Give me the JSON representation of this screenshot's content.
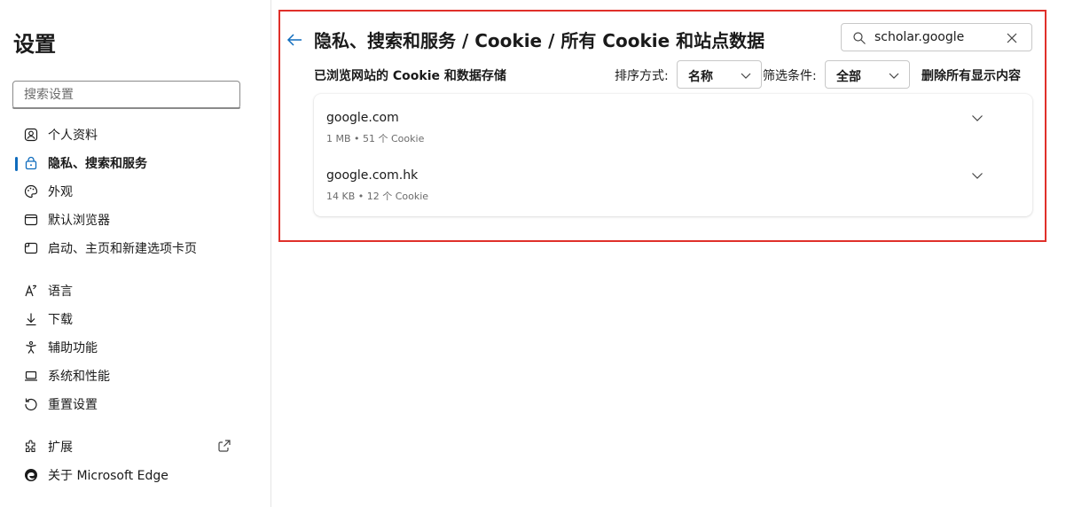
{
  "sidebar": {
    "title": "设置",
    "search_placeholder": "搜索设置",
    "items": [
      {
        "label": "个人资料",
        "icon": "profile-icon"
      },
      {
        "label": "隐私、搜索和服务",
        "icon": "lock-icon",
        "active": true
      },
      {
        "label": "外观",
        "icon": "palette-icon"
      },
      {
        "label": "默认浏览器",
        "icon": "browser-icon"
      },
      {
        "label": "启动、主页和新建选项卡页",
        "icon": "home-tab-icon"
      },
      {
        "label": "语言",
        "icon": "language-icon"
      },
      {
        "label": "下载",
        "icon": "download-icon"
      },
      {
        "label": "辅助功能",
        "icon": "accessibility-icon"
      },
      {
        "label": "系统和性能",
        "icon": "laptop-icon"
      },
      {
        "label": "重置设置",
        "icon": "reset-icon"
      },
      {
        "label": "扩展",
        "icon": "extensions-icon"
      },
      {
        "label": "关于 Microsoft Edge",
        "icon": "edge-logo-icon"
      }
    ]
  },
  "main": {
    "breadcrumb": "隐私、搜索和服务 / Cookie / 所有 Cookie 和站点数据",
    "filter_value": "scholar.google",
    "section_title": "已浏览网站的 Cookie 和数据存储",
    "sort_label": "排序方式:",
    "sort_value": "名称",
    "filter_label": "筛选条件:",
    "filter_select_value": "全部",
    "delete_all_label": "删除所有显示内容",
    "sites": [
      {
        "domain": "google.com",
        "details": "1 MB • 51 个 Cookie"
      },
      {
        "domain": "google.com.hk",
        "details": "14 KB • 12 个 Cookie"
      }
    ]
  },
  "colors": {
    "accent": "#0f6cbd",
    "highlight_border": "#e0302a"
  }
}
